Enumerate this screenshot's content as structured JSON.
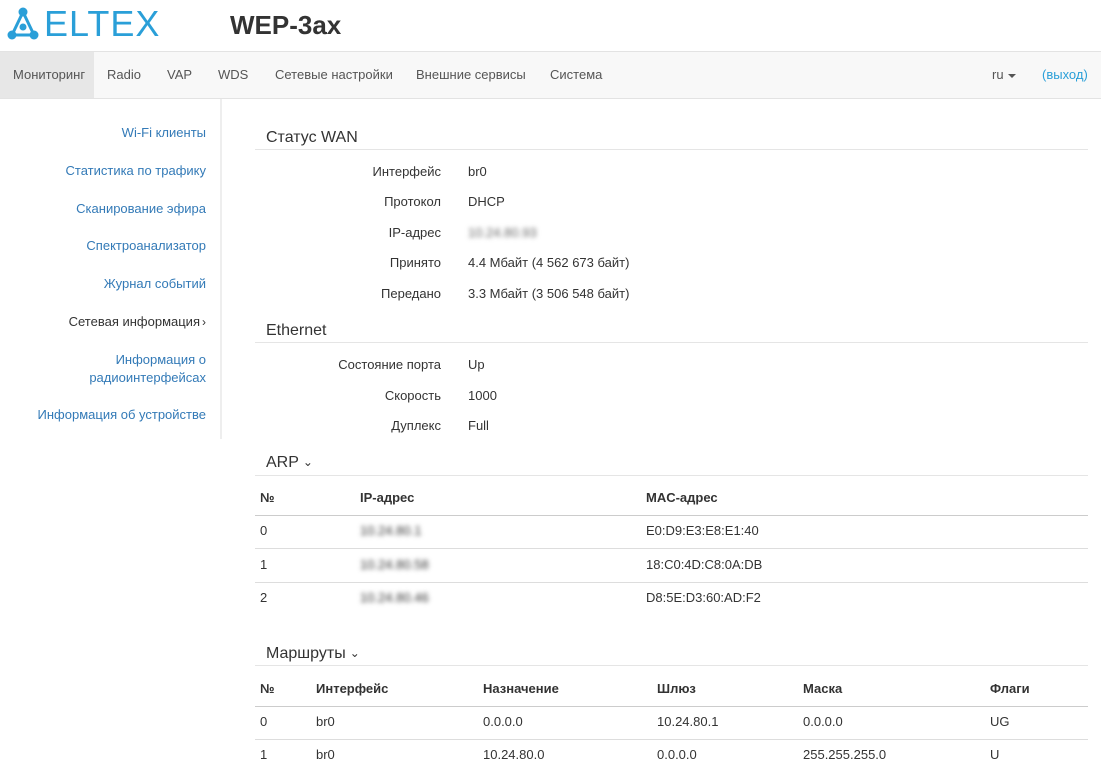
{
  "header": {
    "logo_text": "ELTEX",
    "product": "WEP-3ax"
  },
  "nav": {
    "items": [
      "Мониторинг",
      "Radio",
      "VAP",
      "WDS",
      "Сетевые настройки",
      "Внешние сервисы",
      "Система"
    ],
    "active": "Мониторинг",
    "lang": "ru",
    "logout": "(выход)"
  },
  "sidebar": {
    "items": [
      {
        "label": "Wi-Fi клиенты"
      },
      {
        "label": "Статистика по трафику"
      },
      {
        "label": "Сканирование эфира"
      },
      {
        "label": "Спектроанализатор"
      },
      {
        "label": "Журнал событий"
      },
      {
        "label": "Сетевая информация",
        "chevron": "›"
      },
      {
        "label_line1": "Информация о",
        "label_line2": "радиоинтерфейсах"
      },
      {
        "label": "Информация об устройстве"
      }
    ]
  },
  "wan": {
    "title": "Статус WAN",
    "rows": [
      {
        "label": "Интерфейс",
        "value": "br0"
      },
      {
        "label": "Протокол",
        "value": "DHCP"
      },
      {
        "label": "IP-адрес",
        "value": "10.24.80.93"
      },
      {
        "label": "Принято",
        "value": "4.4 Мбайт (4 562 673 байт)"
      },
      {
        "label": "Передано",
        "value": "3.3 Мбайт (3 506 548 байт)"
      }
    ]
  },
  "ethernet": {
    "title": "Ethernet",
    "rows": [
      {
        "label": "Состояние порта",
        "value": "Up"
      },
      {
        "label": "Скорость",
        "value": "1000"
      },
      {
        "label": "Дуплекс",
        "value": "Full"
      }
    ]
  },
  "arp": {
    "title": "ARP",
    "toggle_icon": "chevron-down-icon",
    "columns": [
      "№",
      "IP-адрес",
      "MAC-адрес"
    ],
    "rows": [
      {
        "n": "0",
        "ip": "10.24.80.1",
        "mac": "E0:D9:E3:E8:E1:40"
      },
      {
        "n": "1",
        "ip": "10.24.80.58",
        "mac": "18:C0:4D:C8:0A:DB"
      },
      {
        "n": "2",
        "ip": "10.24.80.46",
        "mac": "D8:5E:D3:60:AD:F2"
      }
    ]
  },
  "routes": {
    "title": "Маршруты",
    "toggle_icon": "chevron-down-icon",
    "columns": [
      "№",
      "Интерфейс",
      "Назначение",
      "Шлюз",
      "Маска",
      "Флаги"
    ],
    "rows": [
      {
        "n": "0",
        "iface": "br0",
        "dest": "0.0.0.0",
        "gw": "10.24.80.1",
        "mask": "0.0.0.0",
        "flags": "UG"
      },
      {
        "n": "1",
        "iface": "br0",
        "dest": "10.24.80.0",
        "gw": "0.0.0.0",
        "mask": "255.255.255.0",
        "flags": "U"
      }
    ]
  },
  "colors": {
    "brand": "#2a9fd8",
    "link": "#337ab7",
    "nav_bg": "#f8f8f8",
    "nav_active_bg": "#e7e7e7"
  }
}
